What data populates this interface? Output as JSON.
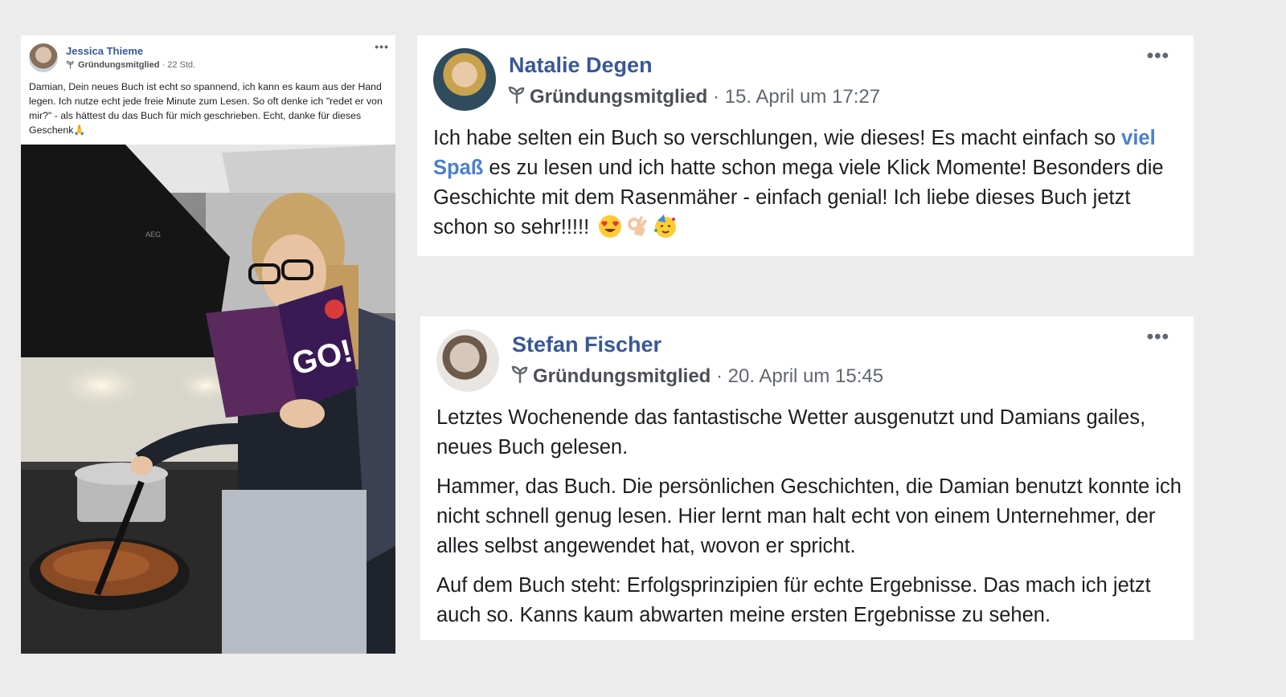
{
  "posts": [
    {
      "author": "Jessica Thieme",
      "badge": "Gründungsmitglied",
      "time": "· 22 Std.",
      "more_label": "•••",
      "text": "Damian, Dein neues Buch ist echt so spannend, ich kann es kaum aus der Hand legen. Ich nutze echt jede freie Minute zum Lesen. So oft denke ich \"redet er von mir?\" - als hättest du das Buch für mich geschrieben. Echt, danke für dieses Geschenk🙏",
      "photo": {
        "book_title": "GO!",
        "hood_brand": "AEG"
      }
    },
    {
      "author": "Natalie Degen",
      "badge": "Gründungsmitglied",
      "time": "· 15. April um 17:27",
      "more_label": "•••",
      "text_before": "Ich habe selten ein Buch so verschlungen, wie dieses! Es macht einfach so ",
      "text_highlight": "viel Spaß",
      "text_after": " es zu lesen und ich hatte schon mega viele Klick Momente! Besonders die Geschichte mit dem Rasenmäher - einfach genial! Ich liebe dieses Buch jetzt schon so sehr!!!!!",
      "emojis": [
        "heart-eyes-emoji",
        "ok-hand-emoji",
        "party-face-emoji"
      ]
    },
    {
      "author": "Stefan Fischer",
      "badge": "Gründungsmitglied",
      "time": "· 20. April um 15:45",
      "more_label": "•••",
      "paragraphs": [
        "Letztes Wochenende das fantastische Wetter ausgenutzt und Damians gailes, neues Buch gelesen.",
        "Hammer, das Buch. Die persönlichen Geschichten, die Damian benutzt konnte ich nicht schnell genug lesen. Hier lernt man halt echt von einem Unternehmer, der alles selbst angewendet hat, wovon er spricht.",
        "Auf dem Buch steht: Erfolgsprinzipien für echte Ergebnisse. Das mach ich jetzt auch so. Kanns kaum abwarten meine ersten Ergebnisse zu sehen."
      ]
    }
  ],
  "colors": {
    "author_link": "#385898",
    "highlight": "#4a7fd1",
    "meta": "#606770",
    "background": "#ececec"
  }
}
